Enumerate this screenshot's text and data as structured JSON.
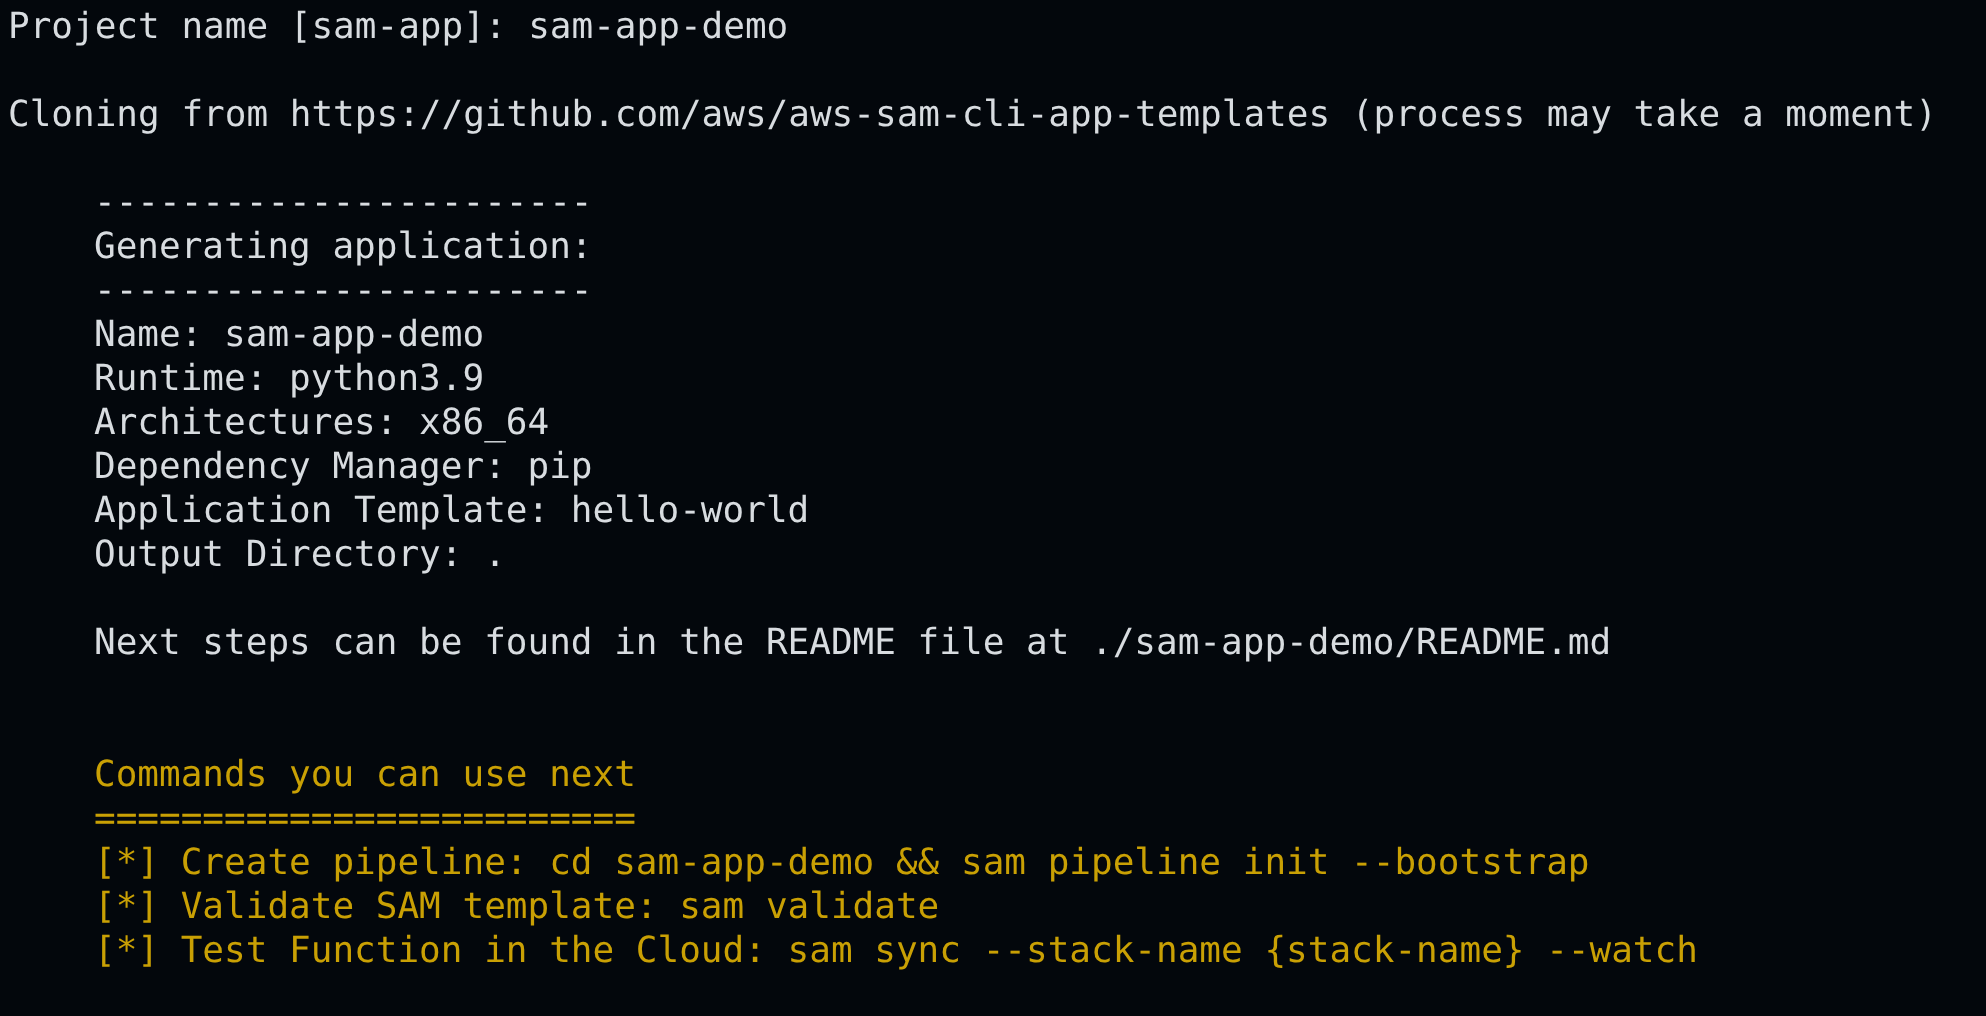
{
  "prompt": "Project name [sam-app]: sam-app-demo",
  "cloning_message": "Cloning from https://github.com/aws/aws-sam-cli-app-templates (process may take a moment)",
  "summary": {
    "rule_top": "-----------------------",
    "heading": "Generating application:",
    "rule_bottom": "-----------------------",
    "fields": [
      "Name: sam-app-demo",
      "Runtime: python3.9",
      "Architectures: x86_64",
      "Dependency Manager: pip",
      "Application Template: hello-world",
      "Output Directory: ."
    ]
  },
  "next_steps": "Next steps can be found in the README file at ./sam-app-demo/README.md",
  "commands": {
    "title": "Commands you can use next",
    "rule": "=========================",
    "items": [
      "[*] Create pipeline: cd sam-app-demo && sam pipeline init --bootstrap",
      "[*] Validate SAM template: sam validate",
      "[*] Test Function in the Cloud: sam sync --stack-name {stack-name} --watch"
    ]
  }
}
